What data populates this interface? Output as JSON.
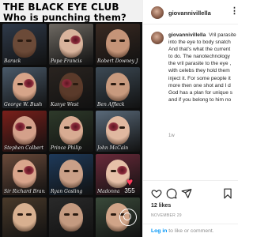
{
  "poster": {
    "title_line1": "THE BLACK EYE CLUB",
    "title_line2": "Who is punching them?",
    "faces": [
      {
        "caption": "Barack",
        "bg": "#2f3a4a",
        "skin": "#6b4a38",
        "bruise": false
      },
      {
        "caption": "Pope Francis",
        "bg": "#6f6a63",
        "skin": "#d9b49d",
        "bruise": true
      },
      {
        "caption": "Robert Downey Jr.",
        "bg": "#3a2a22",
        "skin": "#c59478",
        "bruise": false
      },
      {
        "caption": "George W. Bush",
        "bg": "#4a5a6a",
        "skin": "#d6a489",
        "bruise": true
      },
      {
        "caption": "Kanye West",
        "bg": "#2a2420",
        "skin": "#5a3a2a",
        "bruise": true
      },
      {
        "caption": "Ben Affleck",
        "bg": "#3d4a55",
        "skin": "#c89a7e",
        "bruise": false
      },
      {
        "caption": "Stephen Colbert",
        "bg": "#7a1f1a",
        "skin": "#d4a08a",
        "bruise": true
      },
      {
        "caption": "Prince Philip",
        "bg": "#2e3a2a",
        "skin": "#d8ab92",
        "bruise": true
      },
      {
        "caption": "John McCain",
        "bg": "#5a6a7a",
        "skin": "#e0b8a0",
        "bruise": true
      },
      {
        "caption": "Sir Richard Branson",
        "bg": "#6a4a3a",
        "skin": "#d9a58c",
        "bruise": true
      },
      {
        "caption": "Ryan Gosling",
        "bg": "#1e3a5a",
        "skin": "#caa088",
        "bruise": false
      },
      {
        "caption": "Madonna",
        "bg": "#6a2a3a",
        "skin": "#e6c0a8",
        "bruise": true
      },
      {
        "caption": "",
        "bg": "#4a3a2a",
        "skin": "#d8b090",
        "bruise": false
      },
      {
        "caption": "",
        "bg": "#2a2a2a",
        "skin": "#c49a80",
        "bruise": false
      },
      {
        "caption": "",
        "bg": "#3a4a3a",
        "skin": "#d0a488",
        "bruise": false
      }
    ],
    "like_badge": "355",
    "accent": "#ff3b5c"
  },
  "header": {
    "username": "giovannivillella",
    "menu_glyph": "⋮"
  },
  "comment": {
    "username": "giovannivillella",
    "lines": [
      "Vril parasite",
      "into the eye to body snatch",
      "And that's what the current",
      "to do. The nanotechnology",
      "the vril parasite to the eye ,",
      "with celebs they hold them",
      "inject it. For some people it",
      "more then one shot and I d",
      "God has a plan for unique s",
      "and if you belong to him no"
    ],
    "time": "1w"
  },
  "actions": {
    "icons": [
      "heart-icon",
      "comment-icon",
      "share-icon",
      "save-icon"
    ],
    "likes": "12 likes",
    "date": "NOVEMBER 29"
  },
  "login": {
    "link": "Log in",
    "rest": " to like or comment."
  },
  "colors": {
    "link": "#0095f6",
    "text": "#262626",
    "muted": "#8e8e8e",
    "divider": "#efefef"
  }
}
